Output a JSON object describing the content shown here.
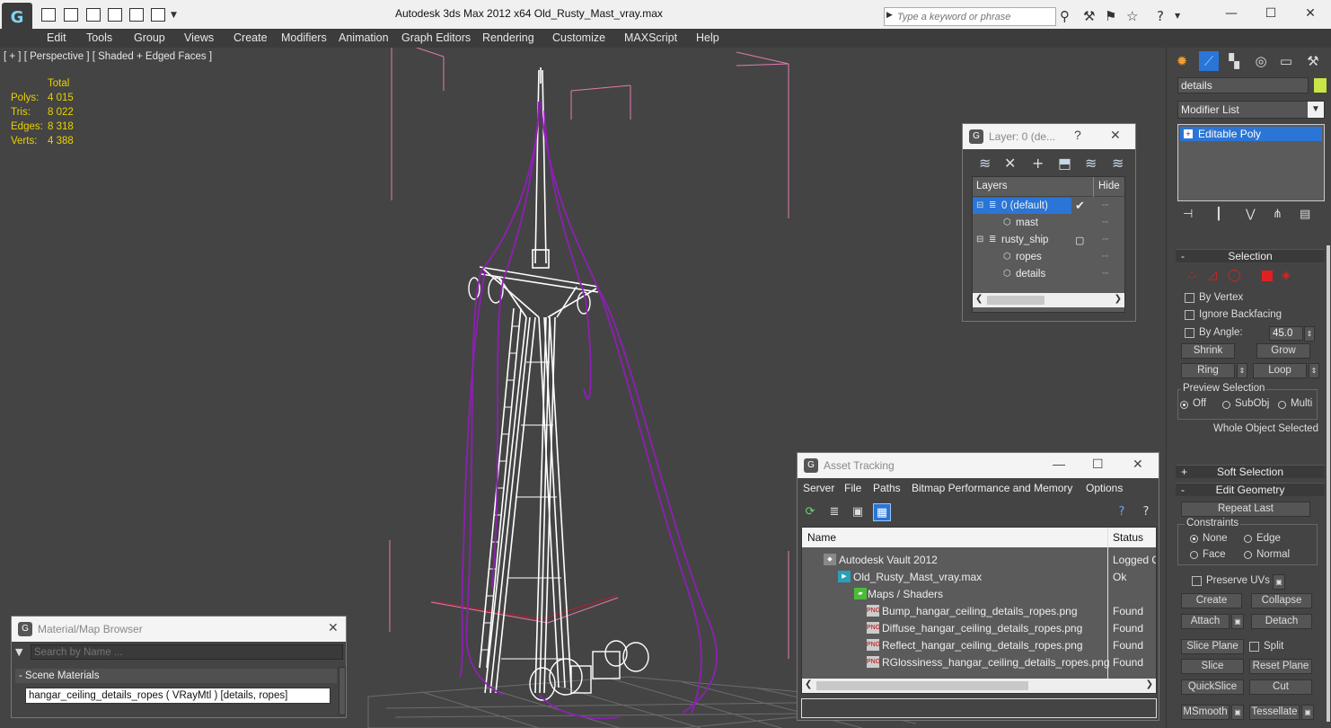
{
  "app": {
    "window_title": "Autodesk 3ds Max  2012 x64       Old_Rusty_Mast_vray.max",
    "search_placeholder": "Type a keyword or phrase"
  },
  "menu": [
    "Edit",
    "Tools",
    "Group",
    "Views",
    "Create",
    "Modifiers",
    "Animation",
    "Graph Editors",
    "Rendering",
    "Customize",
    "MAXScript",
    "Help"
  ],
  "viewport": {
    "label": "[ + ] [ Perspective ] [ Shaded + Edged Faces ]",
    "stats": {
      "header": "Total",
      "rows": [
        {
          "label": "Polys:",
          "value": "4 015"
        },
        {
          "label": "Tris:",
          "value": "8 022"
        },
        {
          "label": "Edges:",
          "value": "8 318"
        },
        {
          "label": "Verts:",
          "value": "4 388"
        }
      ]
    }
  },
  "layer_dialog": {
    "title": "Layer: 0 (de...",
    "help": "?",
    "columns": {
      "layers": "Layers",
      "hide": "Hide"
    },
    "rows": [
      {
        "name": "0 (default)",
        "level": 0,
        "selected": true,
        "current": true
      },
      {
        "name": "mast",
        "level": 1
      },
      {
        "name": "rusty_ship",
        "level": 0
      },
      {
        "name": "ropes",
        "level": 1
      },
      {
        "name": "details",
        "level": 1
      }
    ]
  },
  "asset_tracking": {
    "title": "Asset Tracking",
    "menu": [
      "Server",
      "File",
      "Paths",
      "Bitmap Performance and Memory",
      "Options"
    ],
    "columns": {
      "name": "Name",
      "status": "Status"
    },
    "rows": [
      {
        "name": "Autodesk Vault 2012",
        "status": "Logged O",
        "level": 0,
        "icon": "vault-icon"
      },
      {
        "name": "Old_Rusty_Mast_vray.max",
        "status": "Ok",
        "level": 1,
        "icon": "max-file-icon"
      },
      {
        "name": "Maps / Shaders",
        "status": "",
        "level": 2,
        "icon": "maps-icon"
      },
      {
        "name": "Bump_hangar_ceiling_details_ropes.png",
        "status": "Found",
        "level": 3,
        "icon": "png-icon"
      },
      {
        "name": "Diffuse_hangar_ceiling_details_ropes.png",
        "status": "Found",
        "level": 3,
        "icon": "png-icon"
      },
      {
        "name": "Reflect_hangar_ceiling_details_ropes.png",
        "status": "Found",
        "level": 3,
        "icon": "png-icon"
      },
      {
        "name": "RGlossiness_hangar_ceiling_details_ropes.png",
        "status": "Found",
        "level": 3,
        "icon": "png-icon"
      }
    ]
  },
  "material_browser": {
    "title": "Material/Map Browser",
    "search_placeholder": "Search by Name ...",
    "section": "- Scene Materials",
    "item": "hangar_ceiling_details_ropes  ( VRayMtl )  [details, ropes]"
  },
  "command_panel": {
    "object_name": "details",
    "object_color": "#c9e448",
    "modifier_list": "Modifier List",
    "stack_item": "Editable Poly",
    "selection": {
      "title": "Selection",
      "by_vertex": "By Vertex",
      "ignore_backfacing": "Ignore Backfacing",
      "by_angle": "By Angle:",
      "angle_value": "45.0",
      "shrink": "Shrink",
      "grow": "Grow",
      "ring": "Ring",
      "loop": "Loop",
      "preview_title": "Preview Selection",
      "preview_off": "Off",
      "preview_subobj": "SubObj",
      "preview_multi": "Multi",
      "status": "Whole Object Selected"
    },
    "soft_selection": "Soft Selection",
    "edit_geometry": {
      "title": "Edit Geometry",
      "repeat_last": "Repeat Last",
      "constraints": "Constraints",
      "none": "None",
      "edge": "Edge",
      "face": "Face",
      "normal": "Normal",
      "preserve_uvs": "Preserve UVs",
      "create": "Create",
      "collapse": "Collapse",
      "attach": "Attach",
      "detach": "Detach",
      "slice_plane": "Slice Plane",
      "split": "Split",
      "slice": "Slice",
      "reset_plane": "Reset Plane",
      "quickslice": "QuickSlice",
      "cut": "Cut",
      "msmooth": "MSmooth",
      "tessellate": "Tessellate"
    }
  },
  "colors": {
    "selection_blue": "#2a75d6",
    "stats_yellow": "#e8d200",
    "rope_purple": "#8e1fb4",
    "grid_pink": "#e07cae"
  }
}
